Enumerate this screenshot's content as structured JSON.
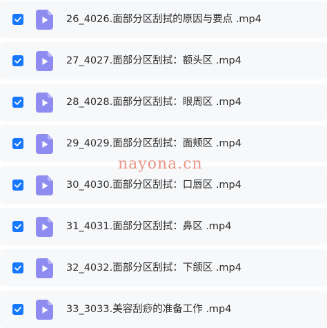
{
  "files": [
    {
      "name": "26_4026.面部分区刮拭的原因与要点 .mp4",
      "checked": true
    },
    {
      "name": "27_4027.面部分区刮拭：额头区 .mp4",
      "checked": true
    },
    {
      "name": "28_4028.面部分区刮拭：眼周区 .mp4",
      "checked": true
    },
    {
      "name": "29_4029.面部分区刮拭：面颊区 .mp4",
      "checked": true
    },
    {
      "name": "30_4030.面部分区刮拭：口唇区 .mp4",
      "checked": true
    },
    {
      "name": "31_4031.面部分区刮拭：鼻区 .mp4",
      "checked": true
    },
    {
      "name": "32_4032.面部分区刮拭：下颌区 .mp4",
      "checked": true
    },
    {
      "name": "33_3033.美容刮痧的准备工作 .mp4",
      "checked": true
    }
  ],
  "watermark": "nayona.cn",
  "colors": {
    "checkbox": "#1677ff",
    "file_icon": "#8e8cf0",
    "row_background": "#f7f8fa"
  },
  "icons": {
    "checkbox": "checkmark-icon",
    "file": "video-file-icon"
  }
}
